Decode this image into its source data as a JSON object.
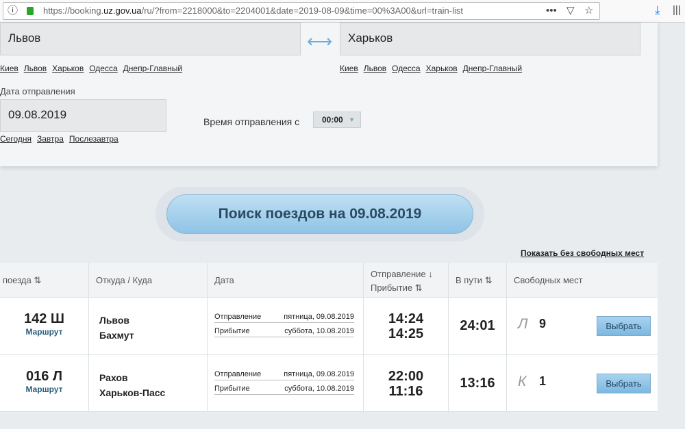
{
  "browser": {
    "url_prefix": "https://booking.",
    "url_domain": "uz.gov.ua",
    "url_suffix": "/ru/?from=2218000&to=2204001&date=2019-08-09&time=00%3A00&url=train-list"
  },
  "form": {
    "from": "Львов",
    "to": "Харьков",
    "from_links": [
      "Киев",
      "Львов",
      "Харьков",
      "Одесса",
      "Днепр-Главный"
    ],
    "to_links": [
      "Киев",
      "Львов",
      "Одесса",
      "Харьков",
      "Днепр-Главный"
    ],
    "date_label": "Дата отправления",
    "date": "09.08.2019",
    "date_links": [
      "Сегодня",
      "Завтра",
      "Послезавтра"
    ],
    "time_label": "Время отправления с",
    "time": "00:00"
  },
  "search_button": "Поиск поездов на 09.08.2019",
  "show_without_seats": "Показать без свободных мест",
  "table": {
    "headers": {
      "train": "поезда",
      "route": "Откуда / Куда",
      "date": "Дата",
      "dep": "Отправление",
      "arr": "Прибытие",
      "duration": "В пути",
      "seats": "Свободных мест"
    },
    "rows": [
      {
        "number": "142 Ш",
        "route_link": "Маршрут",
        "from": "Львов",
        "to": "Бахмут",
        "dep_label": "Отправление",
        "dep_date": "пятница, 09.08.2019",
        "arr_label": "Прибытие",
        "arr_date": "суббота, 10.08.2019",
        "dep_time": "14:24",
        "arr_time": "14:25",
        "duration": "24:01",
        "class": "Л",
        "seats": "9",
        "button": "Выбрать"
      },
      {
        "number": "016 Л",
        "route_link": "Маршрут",
        "from": "Рахов",
        "to": "Харьков-Пасс",
        "dep_label": "Отправление",
        "dep_date": "пятница, 09.08.2019",
        "arr_label": "Прибытие",
        "arr_date": "суббота, 10.08.2019",
        "dep_time": "22:00",
        "arr_time": "11:16",
        "duration": "13:16",
        "class": "К",
        "seats": "1",
        "button": "Выбрать"
      }
    ]
  }
}
